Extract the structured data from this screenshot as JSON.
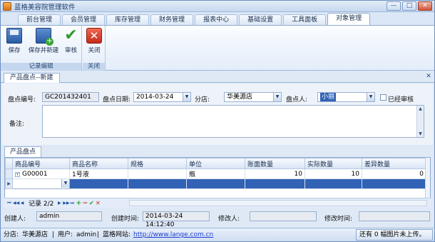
{
  "window": {
    "title": "蓝格美容院管理软件",
    "minimize": "—",
    "maximize": "□",
    "close": "✕"
  },
  "ribbon_tabs": [
    "前台管理",
    "会员管理",
    "库存管理",
    "财务管理",
    "报表中心",
    "基础设置",
    "工具面板",
    "对象管理"
  ],
  "ribbon": {
    "buttons": {
      "save": "保存",
      "save_new": "保存并新建",
      "audit": "审核",
      "close": "关闭"
    },
    "groups": {
      "record_edit": "记录编辑",
      "close": "关闭"
    }
  },
  "doc_tab": {
    "label": "产品盘点--新建",
    "close": "✕"
  },
  "form": {
    "labels": {
      "code": "盘点编号:",
      "date": "盘点日期:",
      "store": "分店:",
      "person": "盘点人:",
      "audited": "已经审核",
      "remark": "备注:"
    },
    "values": {
      "code": "GC201432401",
      "date": "2014-03-24",
      "store": "华美源店",
      "person": "小丽",
      "audited": false,
      "remark": ""
    }
  },
  "grid": {
    "tab": "产品盘点",
    "columns": [
      "商品编号",
      "商品名称",
      "规格",
      "单位",
      "账面数量",
      "实际数量",
      "差异数量"
    ],
    "rows": [
      {
        "code": "G00001",
        "name": "1号液",
        "spec": "",
        "unit": "瓶",
        "book": "10",
        "actual": "10",
        "diff": "0"
      }
    ],
    "nav_record": "记录 2/2"
  },
  "audit": {
    "labels": {
      "creator": "创建人:",
      "created_time": "创建时间:",
      "modifier": "修改人:",
      "modified_time": "修改时间:"
    },
    "values": {
      "creator": "admin",
      "created_time": "2014-03-24 14:12:40",
      "modifier": "",
      "modified_time": ""
    }
  },
  "status": {
    "store_label": "分店:",
    "store": "华美源店",
    "user_label": "用户:",
    "user": "admin",
    "site_label": "蓝格网站:",
    "site": "http://www.lange.com.cn",
    "upload": "还有 0 幅图片未上传。"
  },
  "colors": {
    "accent": "#3162b5",
    "link": "#1f3fd2",
    "frame": "#8fa9cf"
  }
}
